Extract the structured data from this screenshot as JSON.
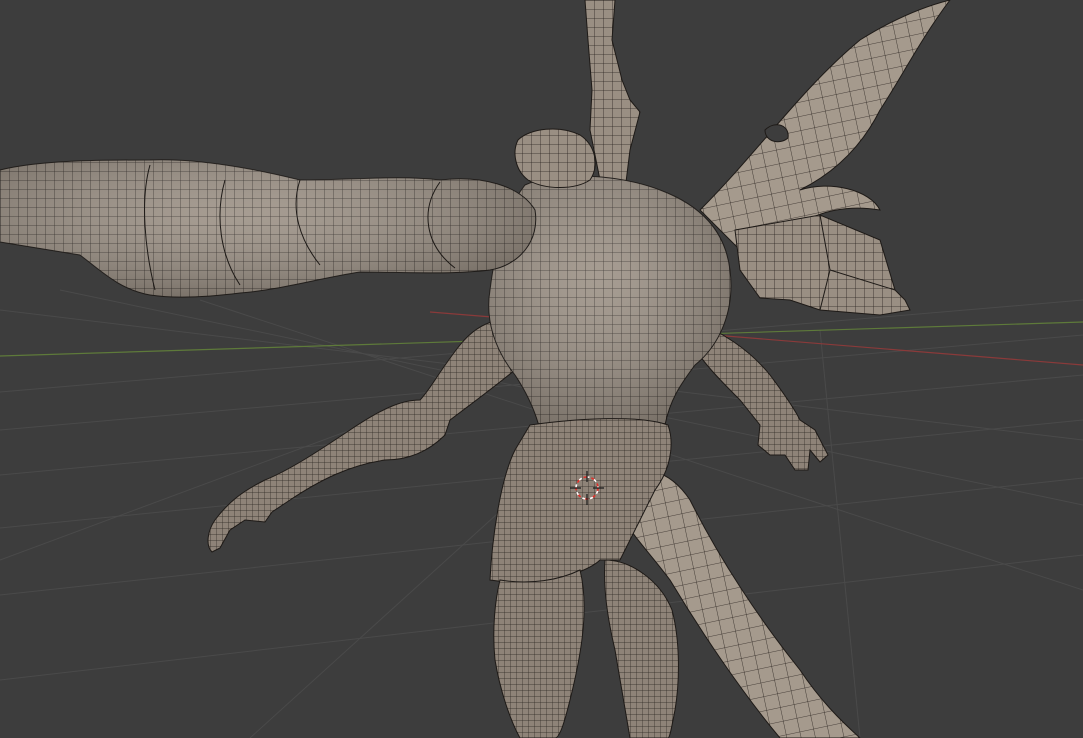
{
  "viewport": {
    "background_color": "#3d3d3d",
    "grid_line_color": "#4a4a4a",
    "x_axis_color": "#8a3a3a",
    "y_axis_color": "#5e7a3a",
    "mesh_fill_color": "#9a8f83",
    "mesh_wire_color": "#2a2420",
    "cursor_color": "#e0302a",
    "shading_mode": "wireframe-overlay",
    "object": "creature-mesh"
  },
  "icons": {
    "cursor": "3d-cursor-icon"
  }
}
